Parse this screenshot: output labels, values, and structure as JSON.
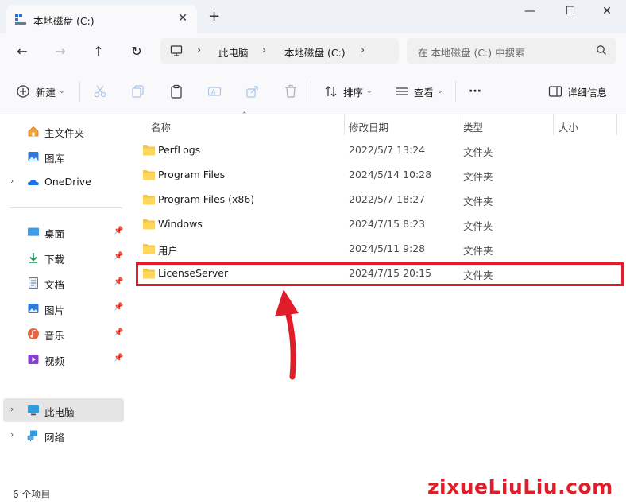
{
  "window": {
    "tab_title": "本地磁盘 (C:)",
    "new_tab": "+",
    "minimize": "—",
    "maximize": "☐",
    "close": "✕"
  },
  "nav": {
    "breadcrumb": [
      "此电脑",
      "本地磁盘 (C:)"
    ],
    "search_placeholder": "在 本地磁盘 (C:) 中搜索"
  },
  "toolbar": {
    "new_label": "新建",
    "sort_label": "排序",
    "view_label": "查看",
    "more_label": "···",
    "details_label": "详细信息"
  },
  "sidebar": {
    "quick": [
      {
        "label": "主文件夹",
        "icon": "home-icon"
      },
      {
        "label": "图库",
        "icon": "gallery-icon"
      },
      {
        "label": "OneDrive",
        "icon": "onedrive-icon"
      }
    ],
    "pinned": [
      {
        "label": "桌面",
        "icon": "desktop-icon"
      },
      {
        "label": "下载",
        "icon": "download-icon"
      },
      {
        "label": "文档",
        "icon": "documents-icon"
      },
      {
        "label": "图片",
        "icon": "pictures-icon"
      },
      {
        "label": "音乐",
        "icon": "music-icon"
      },
      {
        "label": "视频",
        "icon": "videos-icon"
      }
    ],
    "devices": [
      {
        "label": "此电脑",
        "icon": "this-pc-icon"
      },
      {
        "label": "网络",
        "icon": "network-icon"
      }
    ]
  },
  "columns": {
    "name": "名称",
    "modified": "修改日期",
    "type": "类型",
    "size": "大小"
  },
  "files": [
    {
      "name": "PerfLogs",
      "modified": "2022/5/7 13:24",
      "type": "文件夹"
    },
    {
      "name": "Program Files",
      "modified": "2024/5/14 10:28",
      "type": "文件夹"
    },
    {
      "name": "Program Files (x86)",
      "modified": "2022/5/7 18:27",
      "type": "文件夹"
    },
    {
      "name": "Windows",
      "modified": "2024/7/15 8:23",
      "type": "文件夹"
    },
    {
      "name": "用户",
      "modified": "2024/5/11 9:28",
      "type": "文件夹"
    },
    {
      "name": "LicenseServer",
      "modified": "2024/7/15 20:15",
      "type": "文件夹"
    }
  ],
  "status": {
    "item_count": "6 个项目"
  },
  "watermark": {
    "brand": "zixueLiuLiu.com"
  },
  "colors": {
    "accent_red": "#e21d2a",
    "folder_yellow": "#f4c542",
    "selection_gray": "#e5e5e5"
  }
}
